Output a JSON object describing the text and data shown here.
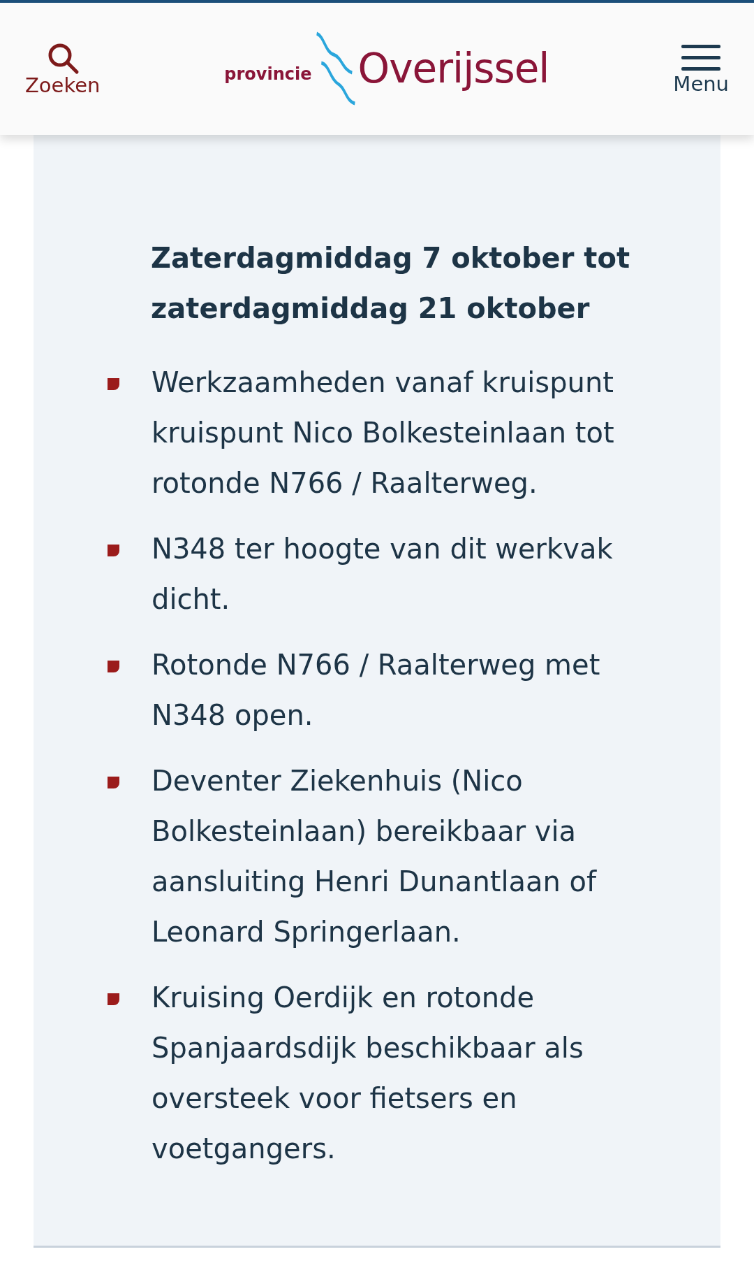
{
  "header": {
    "search_label": "Zoeken",
    "logo": {
      "prefix": "provincie",
      "name": "Overijssel"
    },
    "menu_label": "Menu"
  },
  "content": {
    "heading": "Zaterdagmiddag 7 oktober tot zaterdagmiddag 21 oktober",
    "items": [
      "Werkzaamheden vanaf kruispunt kruispunt Nico Bolkesteinlaan tot rotonde N766 / Raalterweg.",
      "N348 ter hoogte van dit werkvak dicht.",
      "Rotonde N766 / Raalterweg met N348 open.",
      "Deventer Ziekenhuis (Nico Bolkesteinlaan) bereikbaar via aansluiting Henri Dunantlaan of Leonard Springerlaan.",
      "Kruising Oerdijk en rotonde Spanjaardsdijk beschikbaar als oversteek voor fietsers en voetgangers."
    ]
  }
}
